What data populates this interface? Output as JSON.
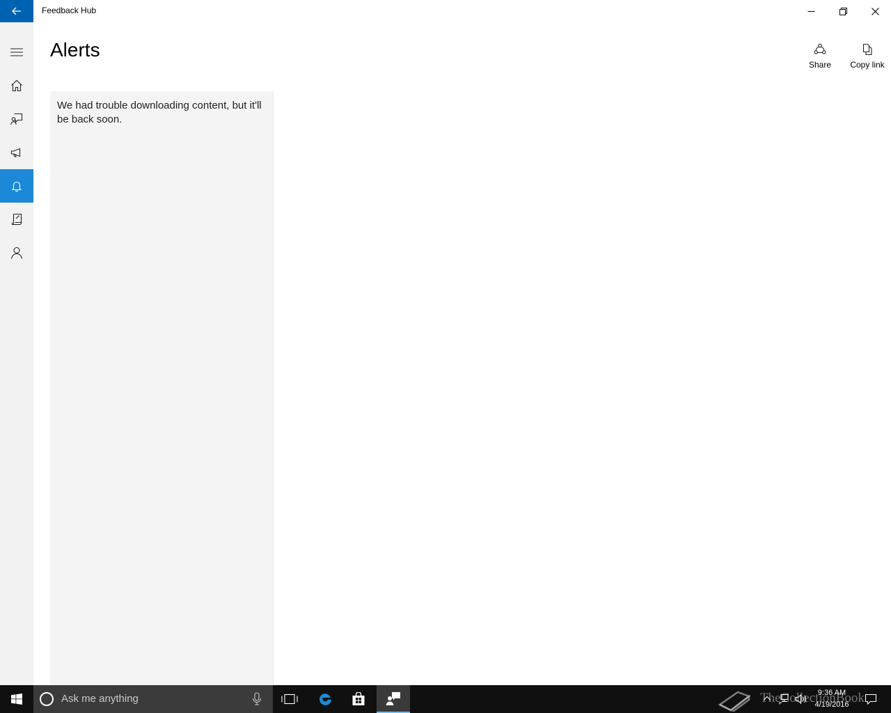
{
  "window": {
    "title": "Feedback Hub"
  },
  "nav": {
    "items": [
      {
        "icon": "hamburger-icon"
      },
      {
        "icon": "home-icon"
      },
      {
        "icon": "feedback-icon"
      },
      {
        "icon": "announcements-icon"
      },
      {
        "icon": "bell-icon",
        "selected": true
      },
      {
        "icon": "quests-icon"
      },
      {
        "icon": "person-icon"
      }
    ]
  },
  "main": {
    "title": "Alerts",
    "commands": {
      "share_label": "Share",
      "copy_link_label": "Copy link"
    },
    "list_message": "We had trouble downloading content, but it'll be back soon."
  },
  "taskbar": {
    "search_placeholder": "Ask me anything",
    "time": "9:36 AM",
    "date": "4/19/2016",
    "watermark_text": "TheCollectionBook"
  },
  "colors": {
    "accent": "#0063b1",
    "nav_selected": "#1b88d8",
    "nav_bg": "#f2f2f2",
    "list_bg": "#f4f4f4",
    "taskbar_bg": "#101010"
  }
}
